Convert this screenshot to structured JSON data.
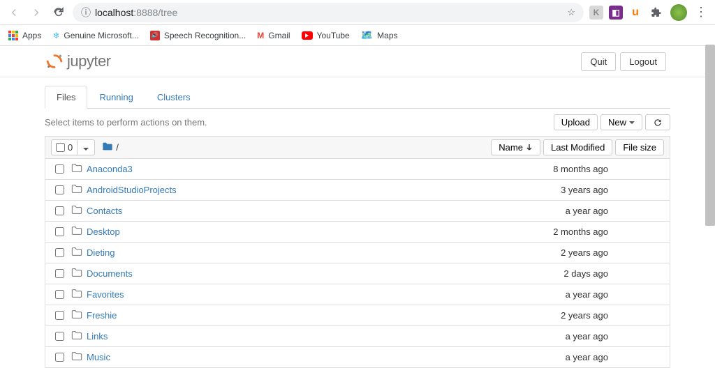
{
  "browser": {
    "url_host": "localhost",
    "url_port_path": ":8888/tree"
  },
  "bookmarks": {
    "apps": "Apps",
    "genuine": "Genuine Microsoft...",
    "speech": "Speech Recognition...",
    "gmail": "Gmail",
    "youtube": "YouTube",
    "maps": "Maps"
  },
  "header": {
    "logo_text": "jupyter",
    "quit": "Quit",
    "logout": "Logout"
  },
  "tabs": {
    "files": "Files",
    "running": "Running",
    "clusters": "Clusters"
  },
  "toolbar": {
    "hint": "Select items to perform actions on them.",
    "upload": "Upload",
    "new": "New",
    "refresh": "↻"
  },
  "list_header": {
    "selected_count": "0",
    "breadcrumb": "/",
    "name_col": "Name",
    "modified_col": "Last Modified",
    "size_col": "File size"
  },
  "files": [
    {
      "name": "Anaconda3",
      "modified": "8 months ago"
    },
    {
      "name": "AndroidStudioProjects",
      "modified": "3 years ago"
    },
    {
      "name": "Contacts",
      "modified": "a year ago"
    },
    {
      "name": "Desktop",
      "modified": "2 months ago"
    },
    {
      "name": "Dieting",
      "modified": "2 years ago"
    },
    {
      "name": "Documents",
      "modified": "2 days ago"
    },
    {
      "name": "Favorites",
      "modified": "a year ago"
    },
    {
      "name": "Freshie",
      "modified": "2 years ago"
    },
    {
      "name": "Links",
      "modified": "a year ago"
    },
    {
      "name": "Music",
      "modified": "a year ago"
    }
  ]
}
